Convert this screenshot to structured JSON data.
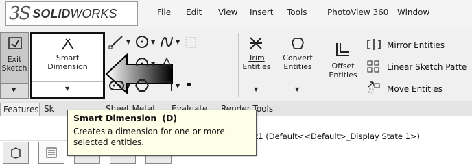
{
  "app": {
    "logo_mark": "3S",
    "logo_text_bold": "SOLID",
    "logo_text_thin": "WORKS"
  },
  "menu": {
    "items": [
      "File",
      "Edit",
      "View",
      "Insert",
      "Tools",
      "PhotoView 360",
      "Window"
    ]
  },
  "ribbon": {
    "exit_sketch": {
      "line1": "Exit",
      "line2": "Sketch"
    },
    "smart_dimension": {
      "line1": "Smart",
      "line2": "Dimension"
    },
    "trim_entities": {
      "line1": "Trim",
      "line2": "Entities"
    },
    "convert_entities": {
      "line1": "Convert",
      "line2": "Entities"
    },
    "offset_entities": {
      "line1": "Offset",
      "line2": "Entities"
    },
    "mirror_entities": "Mirror Entities",
    "linear_sketch_pattern": "Linear Sketch Patte",
    "move_entities": "Move Entities"
  },
  "tabs": [
    "Features",
    "Sk",
    "Sheet Metal",
    "Evaluate",
    "Render Tools"
  ],
  "tree_path": "art1  (Default<<Default>_Display State 1>)",
  "tooltip": {
    "title": "Smart Dimension",
    "shortcut": "(D)",
    "description": "Creates a dimension for one or more selected entities."
  },
  "colors": {
    "ribbon_bg": "#f0f0f0",
    "tooltip_bg": "#ffffe8",
    "highlight_border": "#111111"
  }
}
